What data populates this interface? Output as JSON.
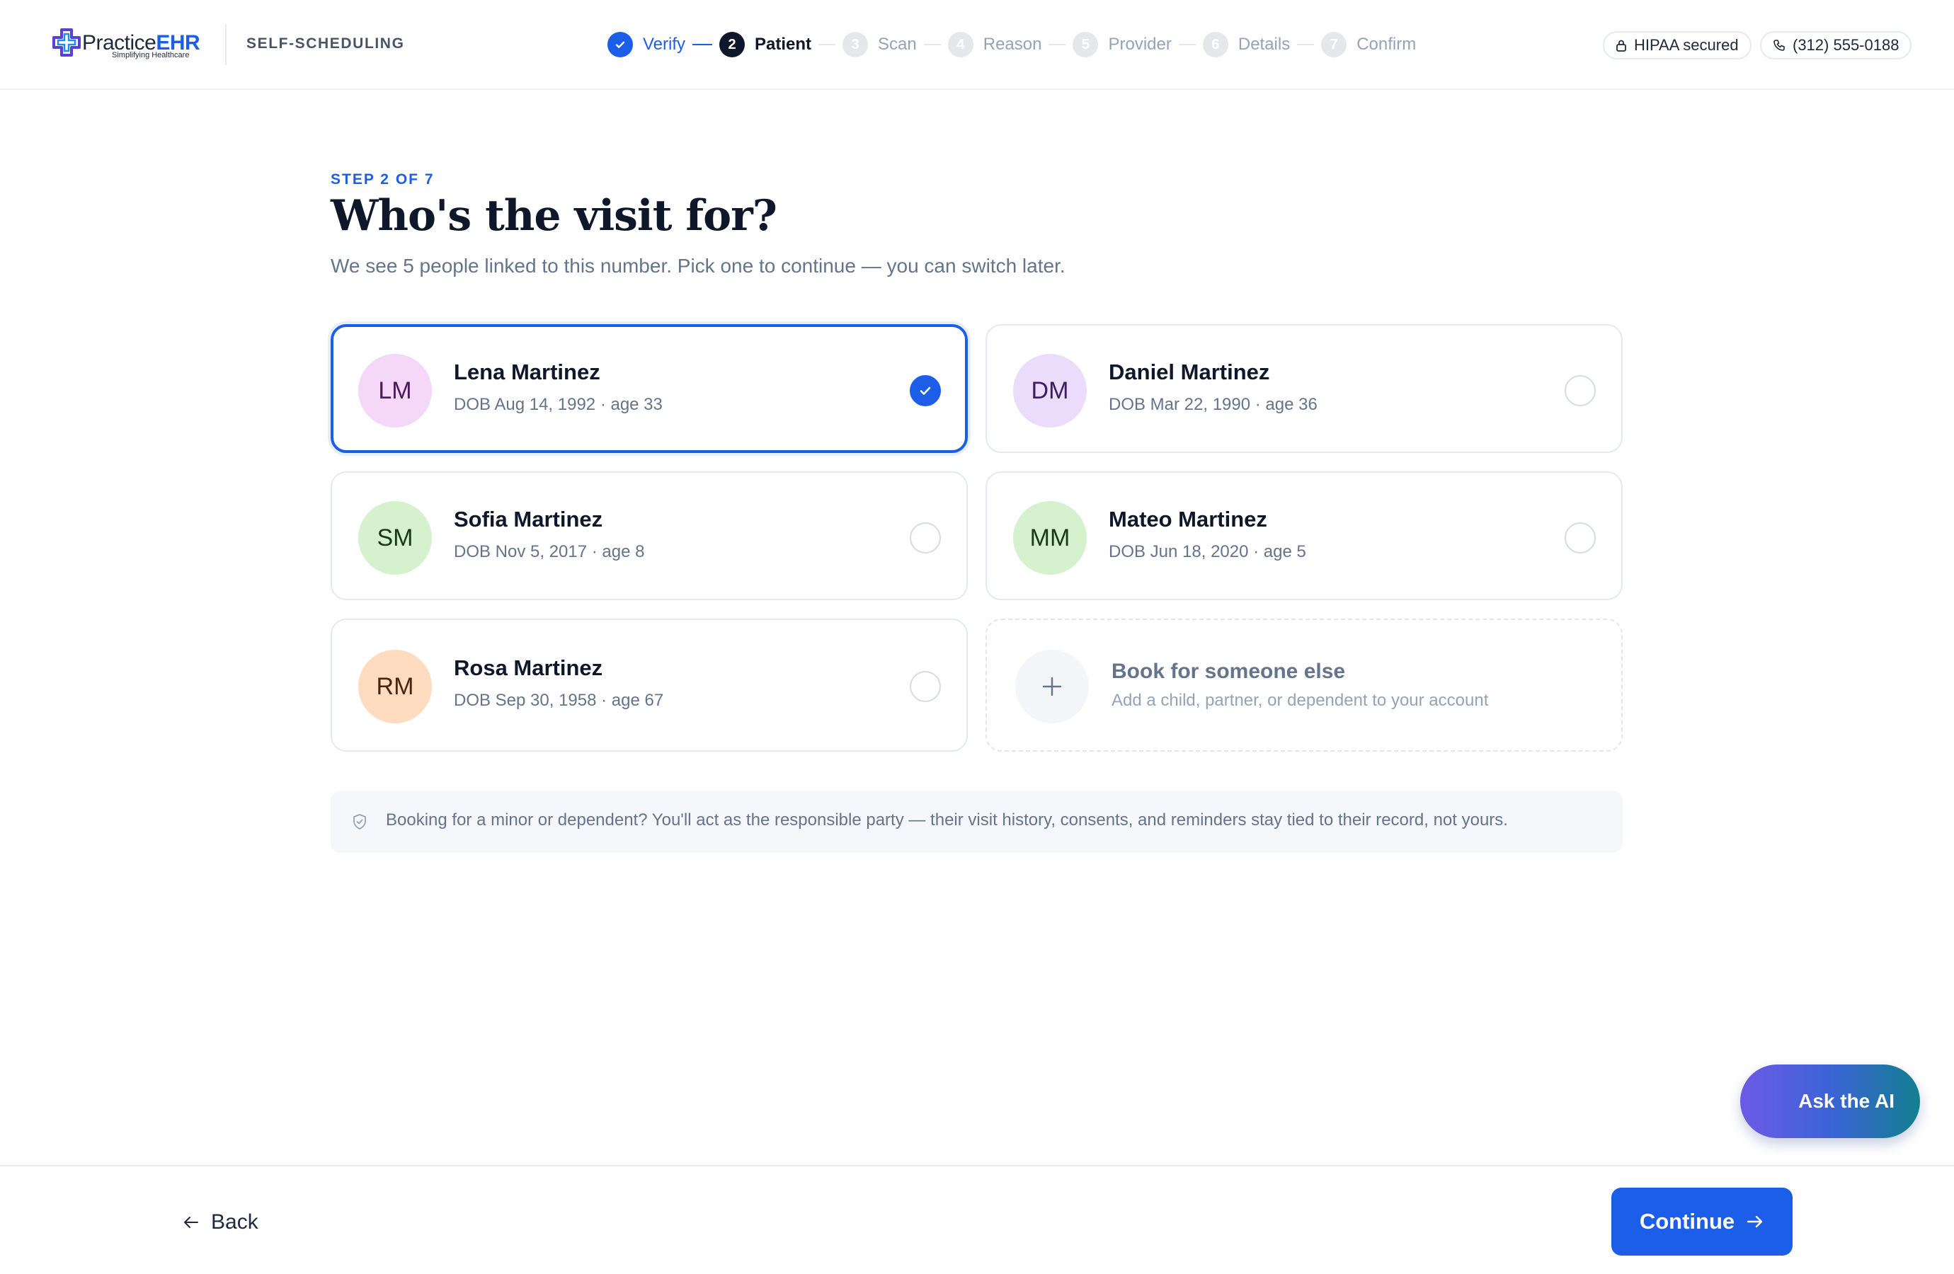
{
  "header": {
    "logo_text_main": "Practice",
    "logo_text_accent": "EHR",
    "logo_tagline": "Simplifying Healthcare",
    "app_label": "SELF-SCHEDULING",
    "hipaa_label": "HIPAA secured",
    "phone_label": "(312) 555-0188"
  },
  "stepper": [
    {
      "num": "1",
      "label": "Verify",
      "state": "done"
    },
    {
      "num": "2",
      "label": "Patient",
      "state": "current"
    },
    {
      "num": "3",
      "label": "Scan",
      "state": "todo"
    },
    {
      "num": "4",
      "label": "Reason",
      "state": "todo"
    },
    {
      "num": "5",
      "label": "Provider",
      "state": "todo"
    },
    {
      "num": "6",
      "label": "Details",
      "state": "todo"
    },
    {
      "num": "7",
      "label": "Confirm",
      "state": "todo"
    }
  ],
  "main": {
    "eyebrow": "STEP 2 OF 7",
    "title": "Who's the visit for?",
    "subtitle": "We see 5 people linked to this number. Pick one to continue — you can switch later."
  },
  "patients": [
    {
      "initials": "LM",
      "name": "Lena Martinez",
      "dob": "DOB Aug 14, 1992 · age 33",
      "selected": true,
      "avatar_bg": "#f5d7f8",
      "avatar_fg": "#4a1a55"
    },
    {
      "initials": "DM",
      "name": "Daniel Martinez",
      "dob": "DOB Mar 22, 1990 · age 36",
      "selected": false,
      "avatar_bg": "#ecdcfb",
      "avatar_fg": "#3b1c5e"
    },
    {
      "initials": "SM",
      "name": "Sofia Martinez",
      "dob": "DOB Nov 5, 2017 · age 8",
      "selected": false,
      "avatar_bg": "#d6f1cd",
      "avatar_fg": "#183a12"
    },
    {
      "initials": "MM",
      "name": "Mateo Martinez",
      "dob": "DOB Jun 18, 2020 · age 5",
      "selected": false,
      "avatar_bg": "#d6f1cd",
      "avatar_fg": "#183a12"
    },
    {
      "initials": "RM",
      "name": "Rosa Martinez",
      "dob": "DOB Sep 30, 1958 · age 67",
      "selected": false,
      "avatar_bg": "#ffdcbf",
      "avatar_fg": "#4a2410"
    }
  ],
  "add_card": {
    "title": "Book for someone else",
    "subtitle": "Add a child, partner, or dependent to your account"
  },
  "notice": {
    "text": "Booking for a minor or dependent? You'll act as the responsible party — their visit history, consents, and reminders stay tied to their record, not yours."
  },
  "footer": {
    "back_label": "Back",
    "continue_label": "Continue"
  },
  "ask_ai_label": "Ask the AI",
  "colors": {
    "accent": "#1d5ee8",
    "text": "#0f172a",
    "muted": "#64748b"
  }
}
